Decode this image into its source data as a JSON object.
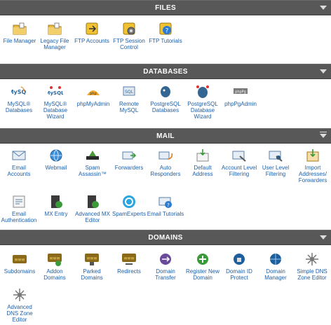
{
  "sections": {
    "files": {
      "title": "FILES",
      "items": [
        {
          "label": "File Manager",
          "icon": "folder-icon"
        },
        {
          "label": "Legacy File Manager",
          "icon": "folder-icon"
        },
        {
          "label": "FTP Accounts",
          "icon": "ftp-icon"
        },
        {
          "label": "FTP Session Control",
          "icon": "ftp-gear-icon"
        },
        {
          "label": "FTP Tutorials",
          "icon": "ftp-help-icon"
        }
      ]
    },
    "databases": {
      "title": "DATABASES",
      "items": [
        {
          "label": "MySQL® Databases",
          "icon": "mysql-icon"
        },
        {
          "label": "MySQL® Database Wizard",
          "icon": "mysql-wizard-icon"
        },
        {
          "label": "phpMyAdmin",
          "icon": "phpmyadmin-icon"
        },
        {
          "label": "Remote MySQL",
          "icon": "remote-mysql-icon"
        },
        {
          "label": "PostgreSQL Databases",
          "icon": "postgresql-icon"
        },
        {
          "label": "PostgreSQL Database Wizard",
          "icon": "postgresql-wizard-icon"
        },
        {
          "label": "phpPgAdmin",
          "icon": "phppgadmin-icon"
        }
      ]
    },
    "mail": {
      "title": "MAIL",
      "items": [
        {
          "label": "Email Accounts",
          "icon": "envelope-icon"
        },
        {
          "label": "Webmail",
          "icon": "globe-icon"
        },
        {
          "label": "Spam Assassin™",
          "icon": "spamassassin-icon"
        },
        {
          "label": "Forwarders",
          "icon": "forward-mail-icon"
        },
        {
          "label": "Auto Responders",
          "icon": "autoresponder-icon"
        },
        {
          "label": "Default Address",
          "icon": "default-address-icon"
        },
        {
          "label": "Account Level Filtering",
          "icon": "filter-mail-icon"
        },
        {
          "label": "User Level Filtering",
          "icon": "user-filter-icon"
        },
        {
          "label": "Import Addresses/ Forwarders",
          "icon": "import-icon"
        },
        {
          "label": "Email Authentication",
          "icon": "authentication-icon"
        },
        {
          "label": "MX Entry",
          "icon": "mx-server-icon"
        },
        {
          "label": "Advanced MX Editor",
          "icon": "mx-editor-icon"
        },
        {
          "label": "SpamExperts",
          "icon": "spamexperts-icon"
        },
        {
          "label": "Email Tutorials",
          "icon": "mail-help-icon"
        }
      ]
    },
    "domains": {
      "title": "DOMAINS",
      "items": [
        {
          "label": "Subdomains",
          "icon": "www-icon"
        },
        {
          "label": "Addon Domains",
          "icon": "www-add-icon"
        },
        {
          "label": "Parked Domains",
          "icon": "www-parked-icon"
        },
        {
          "label": "Redirects",
          "icon": "www-redirect-icon"
        },
        {
          "label": "Domain Transfer",
          "icon": "domain-transfer-icon"
        },
        {
          "label": "Register New Domain",
          "icon": "register-domain-icon"
        },
        {
          "label": "Domain ID Protect",
          "icon": "id-protect-icon"
        },
        {
          "label": "Domain Manager",
          "icon": "domain-manager-icon"
        },
        {
          "label": "Simple DNS Zone Editor",
          "icon": "dns-editor-icon"
        },
        {
          "label": "Advanced DNS Zone Editor",
          "icon": "advanced-dns-icon"
        }
      ]
    }
  }
}
